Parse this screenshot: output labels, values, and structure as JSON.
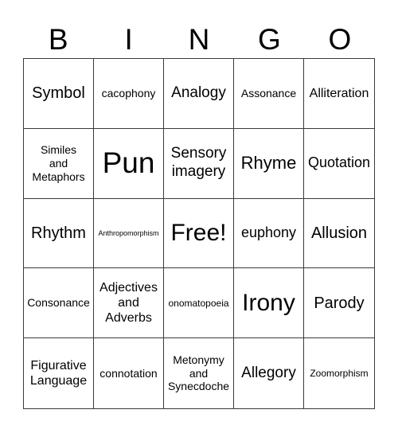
{
  "header": {
    "letters": [
      "B",
      "I",
      "N",
      "G",
      "O"
    ]
  },
  "cells": [
    "Symbol",
    "cacophony",
    "Analogy",
    "Assonance",
    "Alliteration",
    "Similes\nand\nMetaphors",
    "Pun",
    "Sensory\nimagery",
    "Rhyme",
    "Quotation",
    "Rhythm",
    "Anthropomorphism",
    "Free!",
    "euphony",
    "Allusion",
    "Consonance",
    "Adjectives\nand\nAdverbs",
    "onomatopoeia",
    "Irony",
    "Parody",
    "Figurative\nLanguage",
    "connotation",
    "Metonymy\nand\nSynecdoche",
    "Allegory",
    "Zoomorphism"
  ]
}
